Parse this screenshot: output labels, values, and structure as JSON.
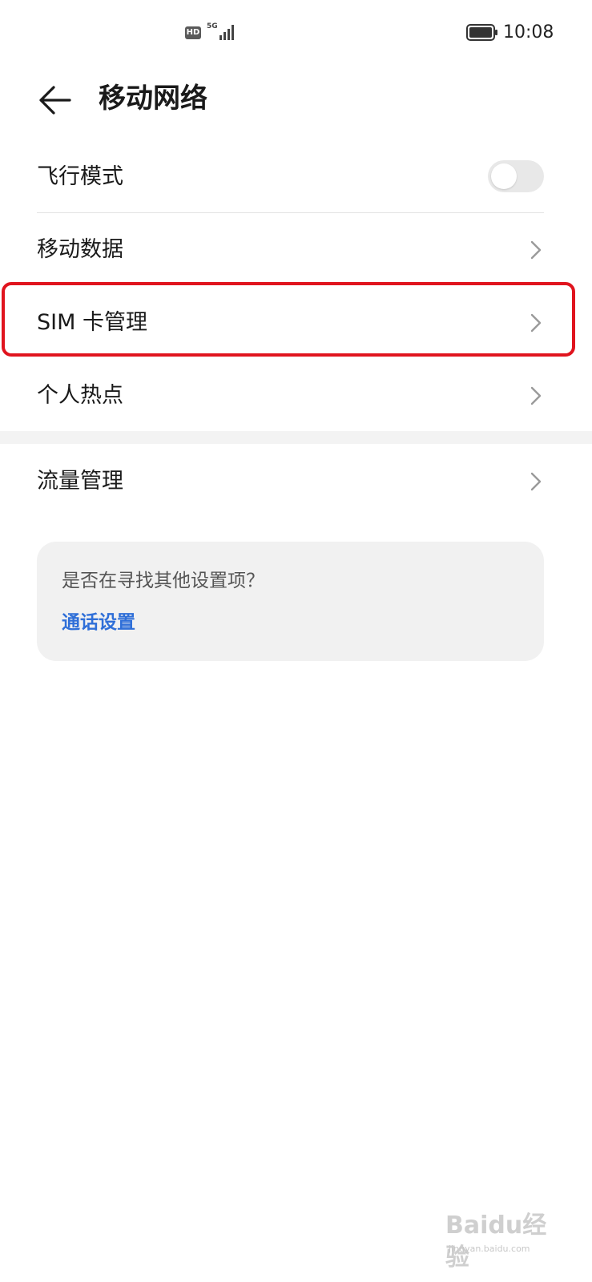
{
  "status_bar": {
    "hd_badge": "HD",
    "network_type": "5G",
    "time": "10:08",
    "icons": [
      "signal-icon",
      "battery-icon"
    ]
  },
  "header": {
    "title": "移动网络",
    "back_icon": "arrow-left-icon"
  },
  "settings": {
    "airplane_mode": {
      "label": "飞行模式",
      "enabled": false
    },
    "mobile_data": {
      "label": "移动数据"
    },
    "sim_management": {
      "label": "SIM 卡管理"
    },
    "hotspot": {
      "label": "个人热点"
    },
    "data_usage": {
      "label": "流量管理"
    }
  },
  "suggestion": {
    "question": "是否在寻找其他设置项？",
    "link": "通话设置"
  },
  "watermark": {
    "logo": "Baidu经验",
    "site": "jingyan.baidu.com"
  },
  "colors": {
    "highlight_border": "#e0141e",
    "link": "#2f6fd8",
    "toggle_off": "#e8e8e8",
    "card_bg": "#f1f1f1"
  }
}
